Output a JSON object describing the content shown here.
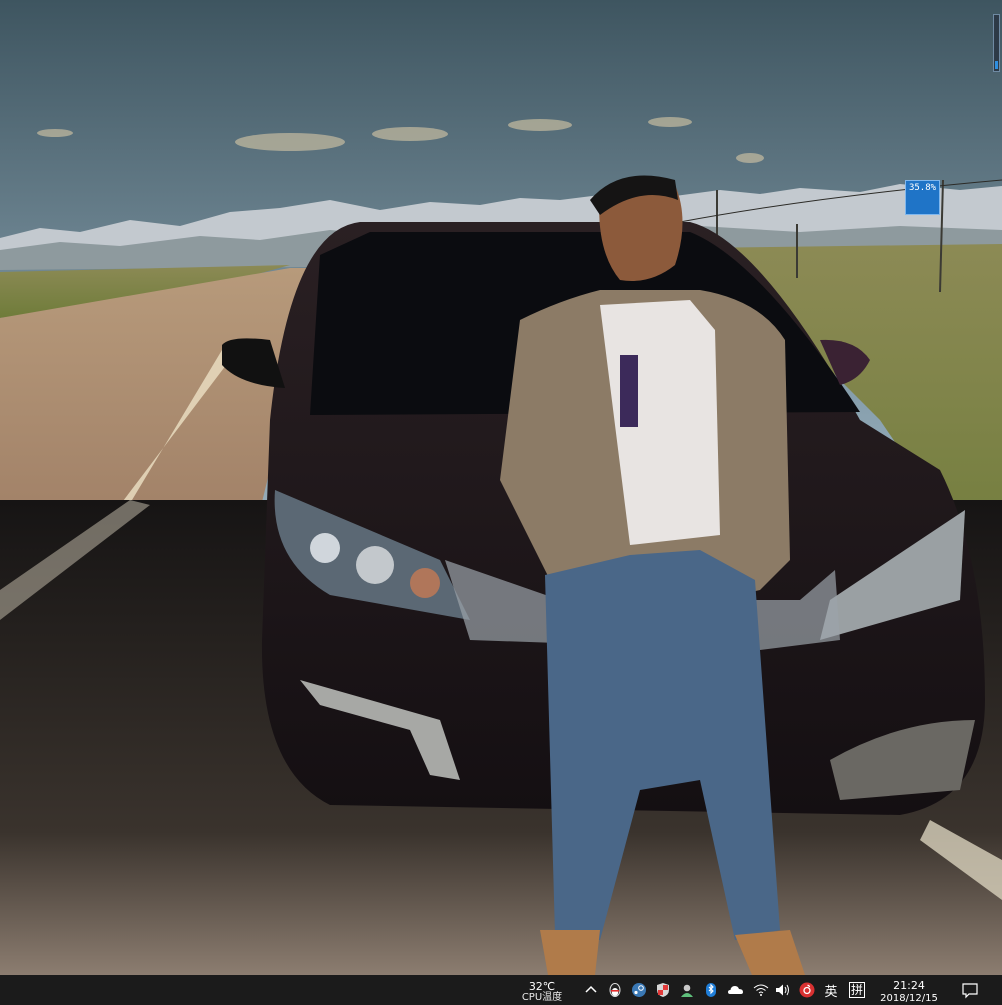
{
  "desktop": {
    "net_usage_widget": {
      "text": "35.8%"
    }
  },
  "taskbar": {
    "temperature": {
      "value": "32℃",
      "label": "CPU温度"
    },
    "tray_icons": [
      "chevron-up-icon",
      "qq-penguin-icon",
      "steam-icon",
      "security-shield-icon",
      "user-app-icon",
      "bluetooth-icon",
      "onedrive-cloud-icon",
      "wifi-icon",
      "speaker-icon",
      "netease-music-icon"
    ],
    "ime": {
      "lang": "英",
      "mode_glyph": "拼"
    },
    "clock": {
      "time": "21:24",
      "date": "2018/12/15"
    },
    "notification_icon": "action-center-icon"
  },
  "colors": {
    "taskbar_bg": "#1b1b1b",
    "widget_bg": "#1f74c7",
    "accent": "#2f8fe0"
  }
}
